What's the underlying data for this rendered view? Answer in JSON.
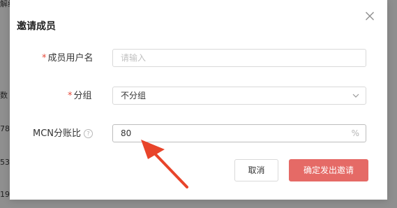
{
  "background": {
    "fragments": [
      "解约",
      "数",
      "78",
      "53",
      "19"
    ]
  },
  "dialog": {
    "title": "邀请成员",
    "close_icon": "close-icon",
    "fields": {
      "username": {
        "required_mark": "*",
        "label": "成员用户名",
        "placeholder": "请输入",
        "value": ""
      },
      "group": {
        "required_mark": "*",
        "label": "分组",
        "value": "不分组",
        "icon": "chevron-down-icon"
      },
      "mcn_ratio": {
        "label": "MCN分账比",
        "help_icon": "question-circle-icon",
        "help_glyph": "?",
        "value": "80",
        "suffix": "%"
      }
    },
    "buttons": {
      "cancel": "取消",
      "confirm": "确定发出邀请"
    }
  },
  "annotation": {
    "icon": "red-arrow-icon",
    "color": "#e8442a"
  },
  "colors": {
    "primary": "#e56a66",
    "required": "#e64a3b",
    "overlay": "#8f8f8f"
  }
}
